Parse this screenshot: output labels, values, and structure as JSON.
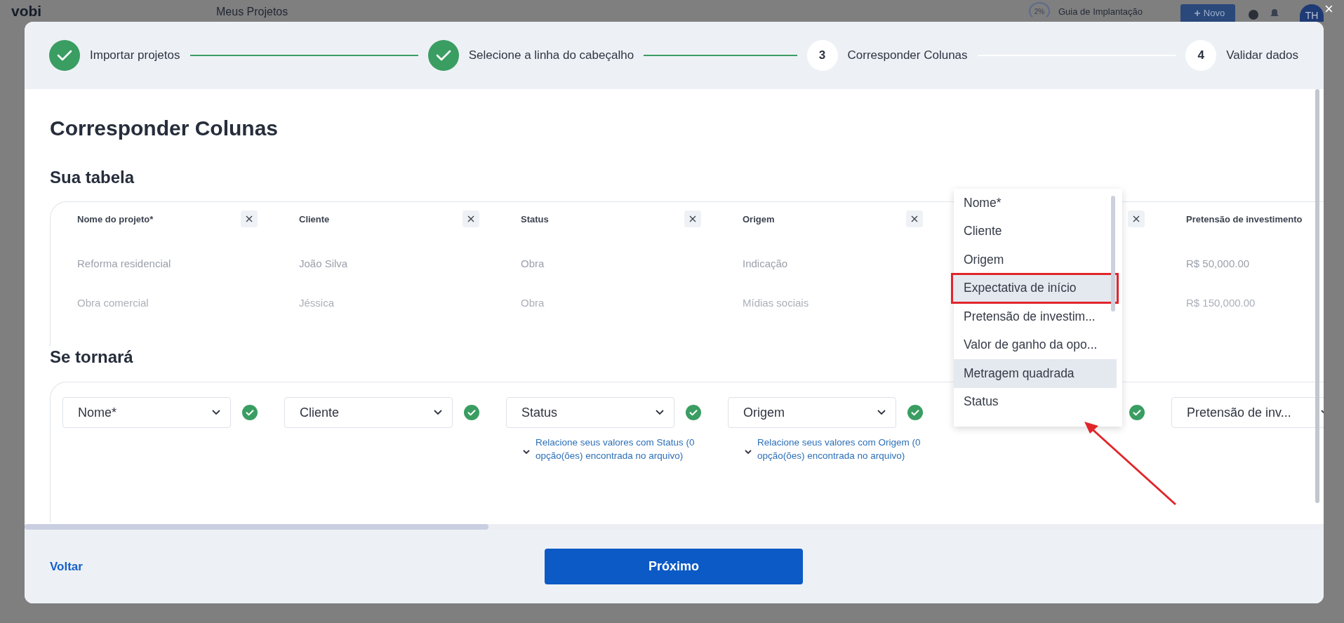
{
  "app_bar": {
    "logo": "vobi",
    "title": "Meus Projetos",
    "progress": "2%",
    "guide": "Guia de Implantação",
    "new_button": "Novo",
    "avatar": "TH"
  },
  "close": "×",
  "steps": [
    {
      "label": "Importar projetos",
      "done": true
    },
    {
      "label": "Selecione a linha do cabeçalho",
      "done": true
    },
    {
      "number": "3",
      "label": "Corresponder Colunas",
      "done": false
    },
    {
      "number": "4",
      "label": "Validar dados",
      "done": false
    }
  ],
  "title": "Corresponder Colunas",
  "source_section": {
    "heading": "Sua tabela",
    "columns": [
      {
        "header": "Nome do projeto*",
        "cells": [
          "Reforma residencial",
          "Obra comercial"
        ],
        "removable": true
      },
      {
        "header": "Cliente",
        "cells": [
          "João Silva",
          "Jéssica"
        ],
        "removable": true
      },
      {
        "header": "Status",
        "cells": [
          "Obra",
          "Obra"
        ],
        "removable": true
      },
      {
        "header": "Origem",
        "cells": [
          "Indicação",
          "Mídias sociais"
        ],
        "removable": true
      },
      {
        "removable": true
      },
      {
        "header": "Pretensão de investimento",
        "cells": [
          "R$ 50,000.00",
          "R$ 150,000.00"
        ]
      }
    ]
  },
  "target_section": {
    "heading": "Se tornará",
    "mappings": [
      {
        "value": "Nome*",
        "matched": true
      },
      {
        "value": "Cliente",
        "matched": true
      },
      {
        "value": "Status",
        "matched": true,
        "relation": "Relacione seus valores com Status (0 opção(ões) encontrada no arquivo)"
      },
      {
        "value": "Origem",
        "matched": true,
        "relation": "Relacione seus valores com Origem (0 opção(ões) encontrada no arquivo)"
      },
      {
        "matched": true
      },
      {
        "value": "Pretensão de inv..."
      }
    ]
  },
  "dropdown": {
    "options": [
      {
        "label": "Nome*",
        "hovered": false,
        "outlined": false
      },
      {
        "label": "Cliente",
        "hovered": false,
        "outlined": false
      },
      {
        "label": "Origem",
        "hovered": false,
        "outlined": false
      },
      {
        "label": "Expectativa de início",
        "hovered": true,
        "outlined": true
      },
      {
        "label": "Pretensão de investim...",
        "hovered": false,
        "outlined": false
      },
      {
        "label": "Valor de ganho da opo...",
        "hovered": false,
        "outlined": false
      },
      {
        "label": "Metragem quadrada",
        "hovered": true,
        "outlined": false
      },
      {
        "label": "Status",
        "hovered": false,
        "outlined": false
      }
    ]
  },
  "footer": {
    "back": "Voltar",
    "next": "Próximo"
  }
}
